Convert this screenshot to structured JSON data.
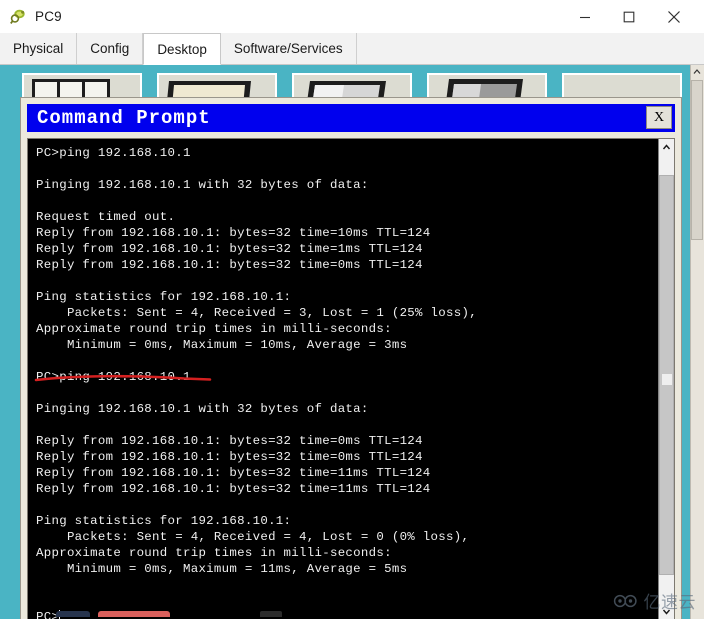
{
  "window": {
    "title": "PC9",
    "icon": "packet-tracer-icon",
    "controls": {
      "minimize": "minimize-icon",
      "maximize": "maximize-icon",
      "close": "close-icon"
    }
  },
  "tabs": [
    {
      "label": "Physical",
      "active": false
    },
    {
      "label": "Config",
      "active": false
    },
    {
      "label": "Desktop",
      "active": true
    },
    {
      "label": "Software/Services",
      "active": false
    }
  ],
  "desktop": {
    "background_color": "#4ab4c4",
    "tiles": [
      {
        "name": "desktop-tile-1"
      },
      {
        "name": "desktop-tile-2"
      },
      {
        "name": "desktop-tile-3"
      },
      {
        "name": "desktop-tile-4"
      },
      {
        "name": "desktop-tile-5"
      }
    ]
  },
  "command_prompt": {
    "title": "Command Prompt",
    "title_bar_color": "#0000ee",
    "close_label": "X",
    "console_lines": [
      "PC>ping 192.168.10.1",
      "",
      "Pinging 192.168.10.1 with 32 bytes of data:",
      "",
      "Request timed out.",
      "Reply from 192.168.10.1: bytes=32 time=10ms TTL=124",
      "Reply from 192.168.10.1: bytes=32 time=1ms TTL=124",
      "Reply from 192.168.10.1: bytes=32 time=0ms TTL=124",
      "",
      "Ping statistics for 192.168.10.1:",
      "    Packets: Sent = 4, Received = 3, Lost = 1 (25% loss),",
      "Approximate round trip times in milli-seconds:",
      "    Minimum = 0ms, Maximum = 10ms, Average = 3ms",
      "",
      "PC>ping 192.168.10.1",
      "",
      "Pinging 192.168.10.1 with 32 bytes of data:",
      "",
      "Reply from 192.168.10.1: bytes=32 time=0ms TTL=124",
      "Reply from 192.168.10.1: bytes=32 time=0ms TTL=124",
      "Reply from 192.168.10.1: bytes=32 time=11ms TTL=124",
      "Reply from 192.168.10.1: bytes=32 time=11ms TTL=124",
      "",
      "Ping statistics for 192.168.10.1:",
      "    Packets: Sent = 4, Received = 4, Lost = 0 (0% loss),",
      "Approximate round trip times in milli-seconds:",
      "    Minimum = 0ms, Maximum = 11ms, Average = 5ms",
      "",
      ""
    ],
    "prompt": "PC>",
    "annotation": {
      "type": "underline",
      "color": "#d42020",
      "target_line": "PC>ping 192.168.10.1"
    }
  },
  "watermark": {
    "text": "亿速云",
    "logo": "cloud-logo-icon"
  }
}
